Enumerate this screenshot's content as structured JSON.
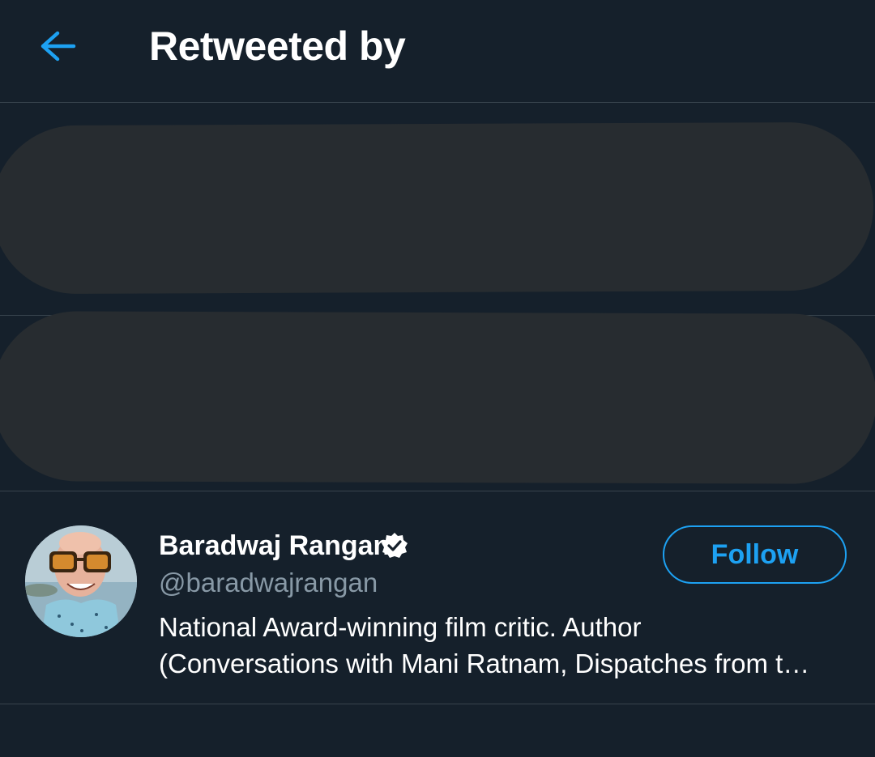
{
  "header": {
    "title": "Retweeted by",
    "back_icon": "arrow-left-icon"
  },
  "colors": {
    "background": "#15202b",
    "accent": "#1da1f2",
    "divider": "#38444d",
    "secondary_text": "#8899a6",
    "redaction": "#272c30"
  },
  "users": [
    {
      "display_name": "Baradwaj Rangan",
      "verified_icon": "verified-badge-icon",
      "handle": "@baradwajrangan",
      "bio_line_1": "National Award-winning film critic. Author",
      "bio_line_2": "(Conversations with Mani Ratnam, Dispatches from t…",
      "follow_label": "Follow"
    }
  ]
}
